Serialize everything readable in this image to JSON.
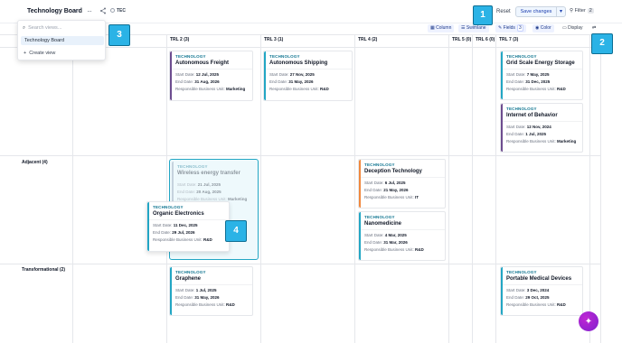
{
  "header": {
    "board_title": "Technology Board",
    "chip": "TEC",
    "reset": "Reset",
    "save": "Save changes",
    "filter": "Filter",
    "filter_count": "2"
  },
  "toolbar": {
    "column": "Column",
    "swimlane": "Swimlane",
    "fields": "Fields",
    "fields_count": "3",
    "color": "Color",
    "display": "Display"
  },
  "columns": [
    "TRL 2 (3)",
    "TRL 3 (1)",
    "TRL 4 (2)",
    "TRL 5 (0)",
    "TRL 6 (0)",
    "TRL 7 (3)"
  ],
  "rows": [
    "Adjacent (4)",
    "Transformational (2)"
  ],
  "dropdown": {
    "placeholder": "Search views...",
    "selected": "Technology Board",
    "create": "Create view"
  },
  "labels": {
    "start": "Start Date:",
    "end": "End Date:",
    "unit": "Responsible Business Unit:"
  },
  "cards": {
    "c1": {
      "type": "TECHNOLOGY",
      "title": "Autonomous Freight",
      "start": "12 Jul, 2025",
      "end": "31 Aug, 2026",
      "unit": "Marketing"
    },
    "c2": {
      "type": "TECHNOLOGY",
      "title": "Autonomous Shipping",
      "start": "27 Nov, 2025",
      "end": "31 May, 2026",
      "unit": "R&D"
    },
    "c3": {
      "type": "TECHNOLOGY",
      "title": "Grid Scale Energy Storage",
      "start": "7 May, 2025",
      "end": "31 Dec, 2025",
      "unit": "R&D"
    },
    "c4": {
      "type": "TECHNOLOGY",
      "title": "Internet of Behavior",
      "start": "12 Nov, 2024",
      "end": "1 Jul, 2025",
      "unit": "Marketing"
    },
    "c5": {
      "type": "TECHNOLOGY",
      "title": "Wireless energy transfer",
      "start": "21 Jul, 2025",
      "end": "20 Aug, 2025",
      "unit": "Marketing"
    },
    "c6": {
      "type": "TECHNOLOGY",
      "title": "Organic Electronics",
      "start": "11 Dec, 2025",
      "end": "29 Jul, 2026",
      "unit": "R&D"
    },
    "c7": {
      "type": "TECHNOLOGY",
      "title": "Deception Technology",
      "start": "6 Jul, 2025",
      "end": "21 May, 2026",
      "unit": "IT"
    },
    "c8": {
      "type": "TECHNOLOGY",
      "title": "Nanomedicine",
      "start": "4 Mar, 2025",
      "end": "31 Mar, 2026",
      "unit": "R&D"
    },
    "c9": {
      "type": "TECHNOLOGY",
      "title": "Graphene",
      "start": "1 Jul, 2025",
      "end": "31 May, 2026",
      "unit": "R&D"
    },
    "c10": {
      "type": "TECHNOLOGY",
      "title": "Portable Medical Devices",
      "start": "3 Dec, 2024",
      "end": "29 Oct, 2025",
      "unit": "R&D"
    }
  },
  "callouts": [
    "1",
    "2",
    "3",
    "4"
  ],
  "colors": {
    "accent": "#2bb3e6",
    "bar_purple": "#6d4c8f",
    "bar_teal": "#22a6c4",
    "bar_orange": "#f0883e",
    "bar_slate": "#94a3b8"
  }
}
